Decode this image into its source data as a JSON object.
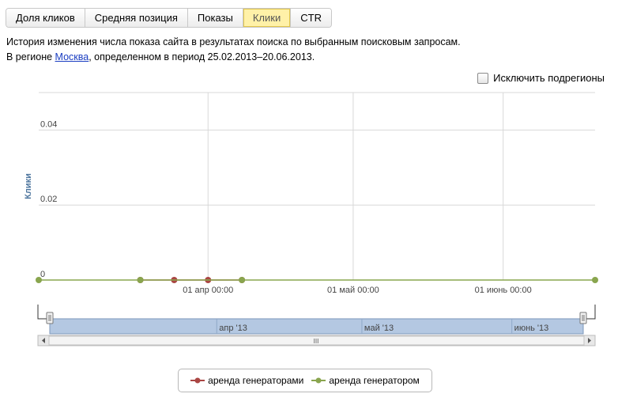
{
  "tabs": [
    {
      "label": "Доля кликов",
      "active": false
    },
    {
      "label": "Средняя позиция",
      "active": false
    },
    {
      "label": "Показы",
      "active": false
    },
    {
      "label": "Клики",
      "active": true
    },
    {
      "label": "CTR",
      "active": false
    }
  ],
  "description": {
    "line1": "История изменения числа показа сайта в результатах поиска по выбранным поисковым запросам.",
    "line2_prefix": "В регионе ",
    "region_link": "Москва",
    "line2_suffix": ", определенном в период 25.02.2013–20.06.2013."
  },
  "exclude_subregions": {
    "label": "Исключить подрегионы",
    "checked": false
  },
  "navigator": {
    "labels": [
      "апр '13",
      "май '13",
      "июнь '13"
    ],
    "scroll_grip": "III"
  },
  "colors": {
    "series1": "#aa4643",
    "series2": "#89a54e",
    "axis_title": "#4d759e",
    "navigator_fill": "#b4c8e2"
  },
  "chart_data": {
    "type": "line",
    "ylabel": "Клики",
    "yticks": [
      "0",
      "0.02",
      "0.04"
    ],
    "ylim": [
      0,
      0.05
    ],
    "xticks": [
      "01 апр 00:00",
      "01 май 00:00",
      "01 июнь 00:00"
    ],
    "series": [
      {
        "name": "аренда генераторами",
        "color": "#aa4643",
        "points": [
          [
            "2013-03-18",
            0
          ],
          [
            "2013-03-25",
            0
          ],
          [
            "2013-04-01",
            0
          ],
          [
            "2013-04-08",
            0
          ]
        ]
      },
      {
        "name": "аренда генератором",
        "color": "#89a54e",
        "points": [
          [
            "2013-02-25",
            0
          ],
          [
            "2013-03-18",
            0
          ],
          [
            "2013-04-08",
            0
          ],
          [
            "2013-06-20",
            0
          ]
        ]
      }
    ]
  }
}
